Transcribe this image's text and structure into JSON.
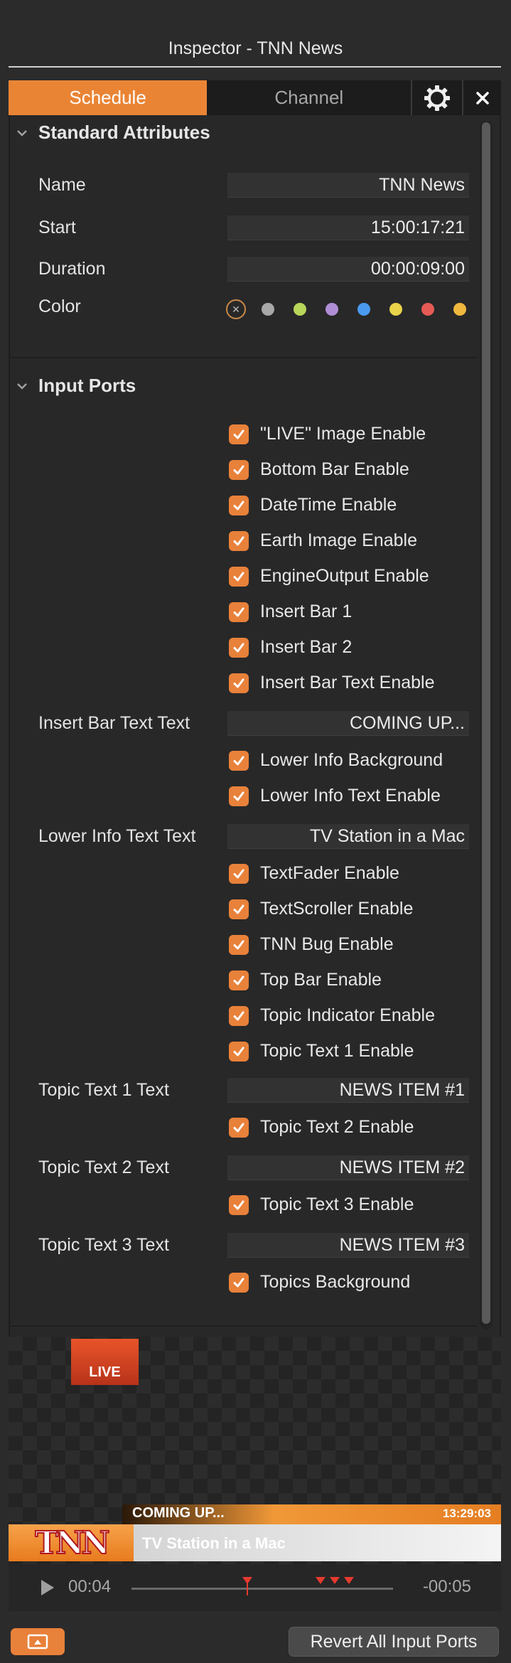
{
  "window": {
    "title": "Inspector - TNN News"
  },
  "tabs": {
    "schedule": "Schedule",
    "channel": "Channel"
  },
  "standard": {
    "heading": "Standard Attributes",
    "name_label": "Name",
    "name_value": "TNN News",
    "start_label": "Start",
    "start_value": "15:00:17:21",
    "duration_label": "Duration",
    "duration_value": "00:00:09:00",
    "color_label": "Color",
    "swatches": [
      "#a8a8a8",
      "#b8d65a",
      "#b08ed6",
      "#4a9bf0",
      "#e8d34a",
      "#e65a55",
      "#f0b83e"
    ]
  },
  "ports": {
    "heading": "Input Ports",
    "checks": [
      "\"LIVE\" Image Enable",
      "Bottom Bar Enable",
      "DateTime Enable",
      "Earth Image Enable",
      "EngineOutput Enable",
      "Insert Bar 1",
      "Insert Bar 2",
      "Insert Bar Text Enable",
      "Lower Info Background",
      "Lower Info Text Enable",
      "TextFader Enable",
      "TextScroller Enable",
      "TNN Bug Enable",
      "Top Bar Enable",
      "Topic Indicator Enable",
      "Topic Text 1 Enable",
      "Topic Text 2 Enable",
      "Topic Text 3 Enable",
      "Topics Background"
    ],
    "insert_bar_text_label": "Insert Bar Text Text",
    "insert_bar_text_value": "COMING UP...",
    "lower_info_text_label": "Lower Info Text Text",
    "lower_info_text_value": "TV Station in a Mac",
    "topic1_label": "Topic Text 1 Text",
    "topic1_value": "NEWS ITEM #1",
    "topic2_label": "Topic Text 2 Text",
    "topic2_value": "NEWS ITEM #2",
    "topic3_label": "Topic Text 3 Text",
    "topic3_value": "NEWS ITEM #3"
  },
  "preview": {
    "live": "LIVE",
    "insert_text": "COMING UP...",
    "clock": "13:29:03",
    "logo": "TNN",
    "lower_text": "TV Station in a Mac"
  },
  "transport": {
    "current": "00:04",
    "remaining": "-00:05"
  },
  "footer": {
    "revert": "Revert All Input Ports"
  }
}
